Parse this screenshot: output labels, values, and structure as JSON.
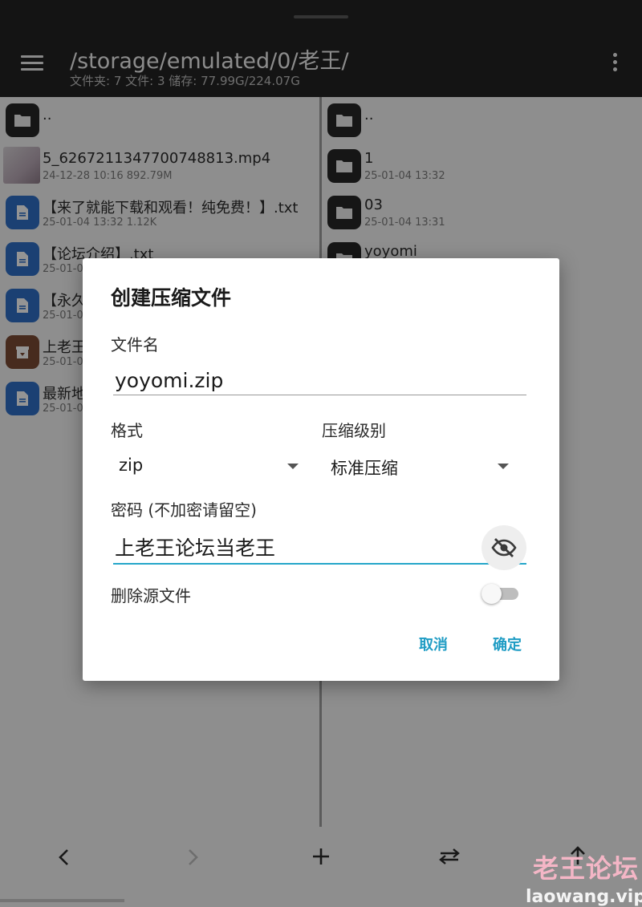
{
  "header": {
    "path": "/storage/emulated/0/老王/",
    "info": "文件夹: 7  文件: 3  储存: 77.99G/224.07G"
  },
  "left_pane": {
    "items": [
      {
        "name": "..",
        "meta": ""
      },
      {
        "name": "5_6267211347700748813.mp4",
        "meta": "24-12-28 10:16  892.79M"
      },
      {
        "name": "【来了就能下载和观看！纯免费！】.txt",
        "meta": "25-01-04 13:32  1.12K"
      },
      {
        "name": "【论坛介绍】.txt",
        "meta": "25-01-0"
      },
      {
        "name": "【永久地",
        "meta": "25-01-0"
      },
      {
        "name": "上老王",
        "meta": "25-01-0"
      },
      {
        "name": "最新地",
        "meta": "25-01-0"
      }
    ]
  },
  "right_pane": {
    "items": [
      {
        "name": "..",
        "meta": ""
      },
      {
        "name": "1",
        "meta": "25-01-04 13:32"
      },
      {
        "name": "03",
        "meta": "25-01-04 13:31"
      },
      {
        "name": "yoyomi",
        "meta": ""
      }
    ]
  },
  "dialog": {
    "title": "创建压缩文件",
    "filename_label": "文件名",
    "filename_value": "yoyomi.zip",
    "format_label": "格式",
    "format_value": "zip",
    "level_label": "压缩级别",
    "level_value": "标准压缩",
    "password_label": "密码 (不加密请留空)",
    "password_value": "上老王论坛当老王",
    "delete_source_label": "删除源文件",
    "delete_source_enabled": false,
    "cancel_label": "取消",
    "confirm_label": "确定"
  },
  "bottom_bar": {
    "back_icon": "chevron-left-icon",
    "forward_icon": "chevron-right-icon",
    "add_icon": "plus-icon",
    "swap_icon": "swap-icon",
    "up_icon": "arrow-up-icon"
  },
  "watermark": {
    "title": "老王论坛",
    "url": "laowang.vip"
  },
  "colors": {
    "accent": "#25a6c9",
    "topbar": "#232323",
    "doc_icon": "#2f6fc7",
    "watermark_pink": "#f4b6c6"
  }
}
